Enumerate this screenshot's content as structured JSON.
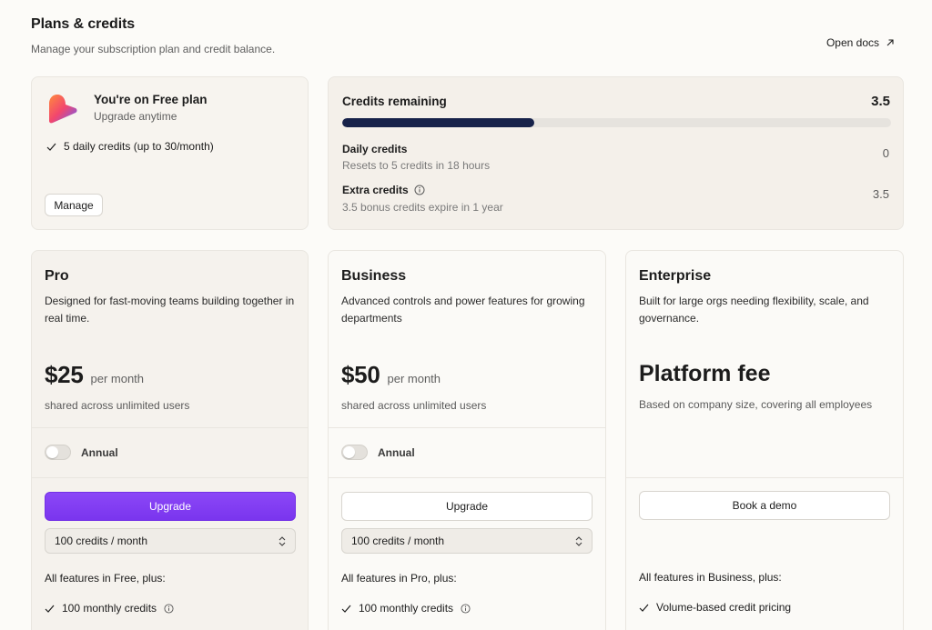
{
  "header": {
    "title": "Plans & credits",
    "subtitle": "Manage your subscription plan and credit balance.",
    "docs_link": "Open docs"
  },
  "current_plan": {
    "title": "You're on Free plan",
    "subtitle": "Upgrade anytime",
    "feature": "5 daily credits (up to 30/month)",
    "manage_label": "Manage"
  },
  "credits": {
    "title": "Credits remaining",
    "total": "3.5",
    "progress_fraction": 0.35,
    "bar_color": "#17224a",
    "daily_label": "Daily credits",
    "daily_sub": "Resets to 5 credits in 18 hours",
    "daily_value": "0",
    "extra_label": "Extra credits",
    "extra_sub": "3.5 bonus credits expire in 1 year",
    "extra_value": "3.5"
  },
  "plans": {
    "pro": {
      "name": "Pro",
      "description": "Designed for fast-moving teams building together in real time.",
      "price": "$25",
      "price_unit": "per month",
      "price_sub": "shared across unlimited users",
      "toggle_label": "Annual",
      "button_label": "Upgrade",
      "credits_select": "100 credits / month",
      "features_heading": "All features in Free, plus:",
      "feature_1": "100 monthly credits"
    },
    "business": {
      "name": "Business",
      "description": "Advanced controls and power features for growing departments",
      "price": "$50",
      "price_unit": "per month",
      "price_sub": "shared across unlimited users",
      "toggle_label": "Annual",
      "button_label": "Upgrade",
      "credits_select": "100 credits / month",
      "features_heading": "All features in Pro, plus:",
      "feature_1": "100 monthly credits"
    },
    "enterprise": {
      "name": "Enterprise",
      "description": "Built for large orgs needing flexibility, scale, and governance.",
      "price": "Platform fee",
      "price_sub": "Based on company size, covering all employees",
      "button_label": "Book a demo",
      "features_heading": "All features in Business, plus:",
      "feature_1": "Volume-based credit pricing"
    }
  },
  "colors": {
    "accent": "#7a35ee",
    "background": "#fcfbf8"
  }
}
